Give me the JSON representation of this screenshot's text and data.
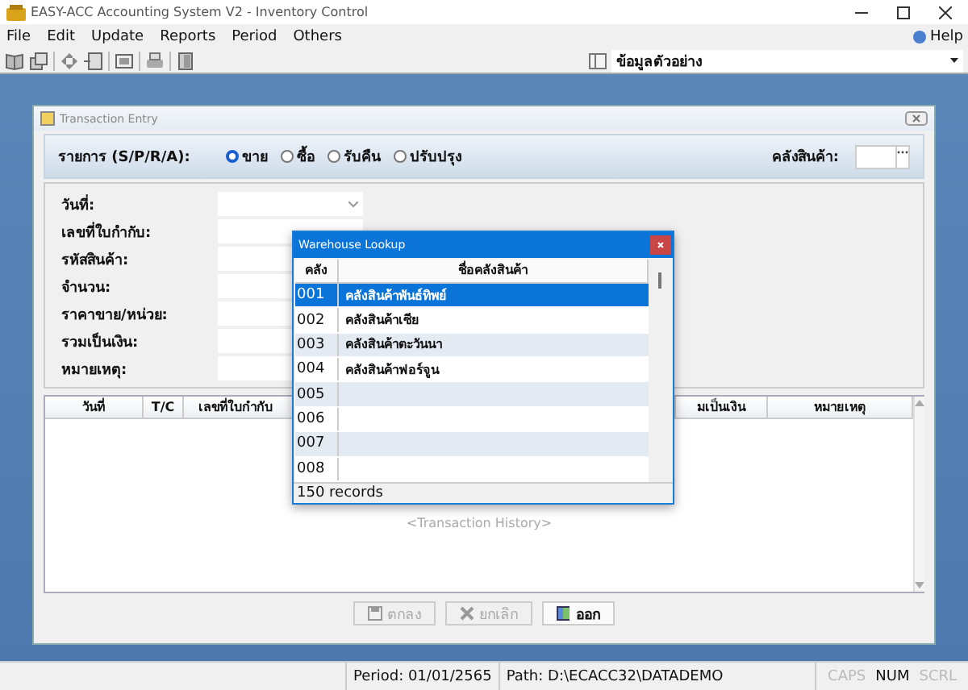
{
  "window": {
    "title": "EASY-ACC Accounting System V2 - Inventory Control"
  },
  "menu": [
    {
      "label": "File"
    },
    {
      "label": "Edit"
    },
    {
      "label": "Update"
    },
    {
      "label": "Reports"
    },
    {
      "label": "Period"
    },
    {
      "label": "Others"
    }
  ],
  "help": {
    "label": "Help"
  },
  "company_selector": {
    "value": "ข้อมูลตัวอย่าง"
  },
  "transaction_window": {
    "title": "Transaction Entry",
    "type_label": "รายการ (S/P/R/A):",
    "types": [
      {
        "label": "ขาย",
        "selected": true
      },
      {
        "label": "ซื้อ",
        "selected": false
      },
      {
        "label": "รับคืน",
        "selected": false
      },
      {
        "label": "ปรับปรุง",
        "selected": false
      }
    ],
    "warehouse_label": "คลังสินค้า:",
    "fields": [
      {
        "label": "วันที่:",
        "kind": "dropdown"
      },
      {
        "label": "เลขที่ใบกำกับ:",
        "kind": "text"
      },
      {
        "label": "รหัสสินค้า:",
        "kind": "text"
      },
      {
        "label": "จำนวน:",
        "kind": "text"
      },
      {
        "label": "ราคาขาย/หน่วย:",
        "kind": "text"
      },
      {
        "label": "รวมเป็นเงิน:",
        "kind": "text"
      },
      {
        "label": "หมายเหตุ:",
        "kind": "text"
      }
    ],
    "history": {
      "columns": [
        "วันที่",
        "T/C",
        "เลขที่ใบกำกับ",
        "มเป็นเงิน",
        "หมายเหตุ"
      ],
      "placeholder": "<Transaction History>"
    },
    "buttons": [
      {
        "label": "ตกลง",
        "kind": "save",
        "disabled": true
      },
      {
        "label": "ยกเลิก",
        "kind": "cancel",
        "disabled": true
      },
      {
        "label": "ออก",
        "kind": "exit",
        "disabled": false
      }
    ]
  },
  "lookup": {
    "title": "Warehouse Lookup",
    "columns": [
      "คลัง",
      "ชื่อคลังสินค้า"
    ],
    "rows": [
      {
        "code": "001",
        "name": "คลังสินค้าพันธ์ทิพย์",
        "selected": true
      },
      {
        "code": "002",
        "name": "คลังสินค้าเซีย",
        "selected": false
      },
      {
        "code": "003",
        "name": "คลังสินค้าตะวันนา",
        "selected": false
      },
      {
        "code": "004",
        "name": "คลังสินค้าฟอร์จูน",
        "selected": false
      },
      {
        "code": "005",
        "selected": false
      },
      {
        "code": "006",
        "selected": false
      },
      {
        "code": "007",
        "selected": false
      },
      {
        "code": "008",
        "selected": false
      }
    ],
    "footer": "150 records"
  },
  "status_bar": {
    "period": "Period: 01/01/2565",
    "path": "Path: D:\\ECACC32\\DATADEMO",
    "indicators": [
      {
        "label": "CAPS",
        "on": false
      },
      {
        "label": "NUM",
        "on": true
      },
      {
        "label": "SCRL",
        "on": false
      }
    ]
  }
}
